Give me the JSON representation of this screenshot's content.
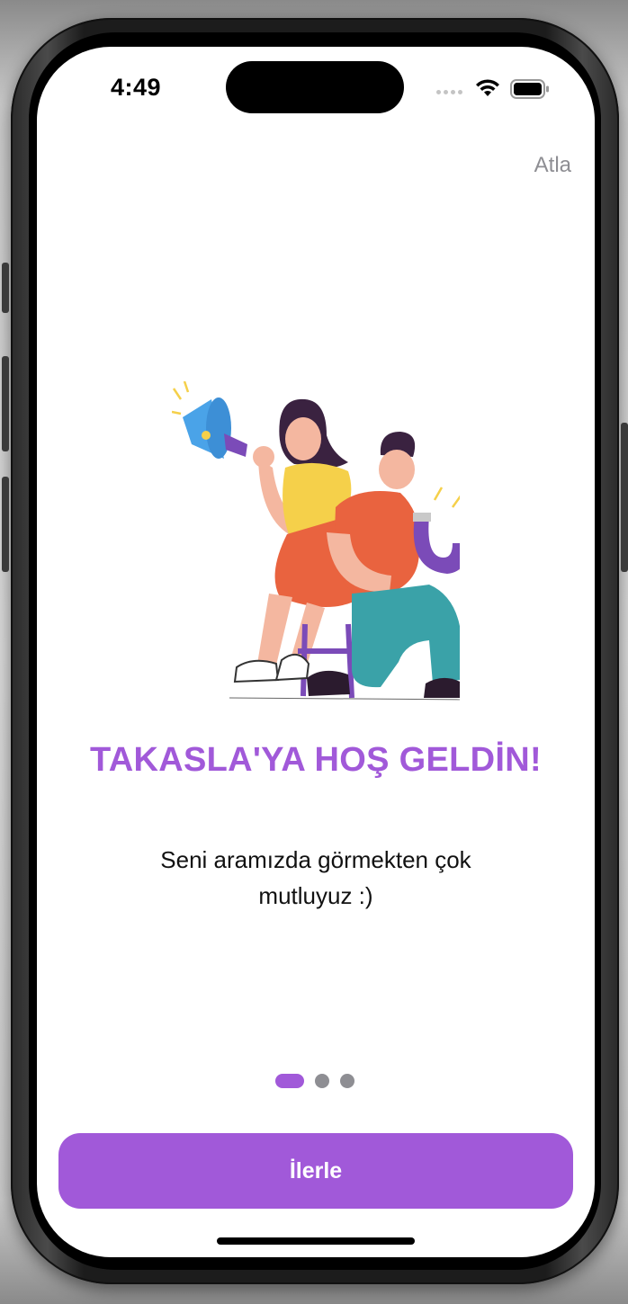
{
  "status_bar": {
    "time": "4:49"
  },
  "header": {
    "skip_label": "Atla"
  },
  "onboarding": {
    "title": "TAKASLA'YA HOŞ GELDİN!",
    "subtitle": "Seni aramızda görmekten çok mutluyuz :)",
    "page_count": 3,
    "current_page": 1,
    "illustration": "two-people-megaphone-magnet-illustration"
  },
  "footer": {
    "next_label": "İlerle"
  },
  "colors": {
    "accent": "#a159d9",
    "inactive_dot": "#8e8e93",
    "skip_text": "#8e8e93",
    "background": "#ffffff"
  }
}
